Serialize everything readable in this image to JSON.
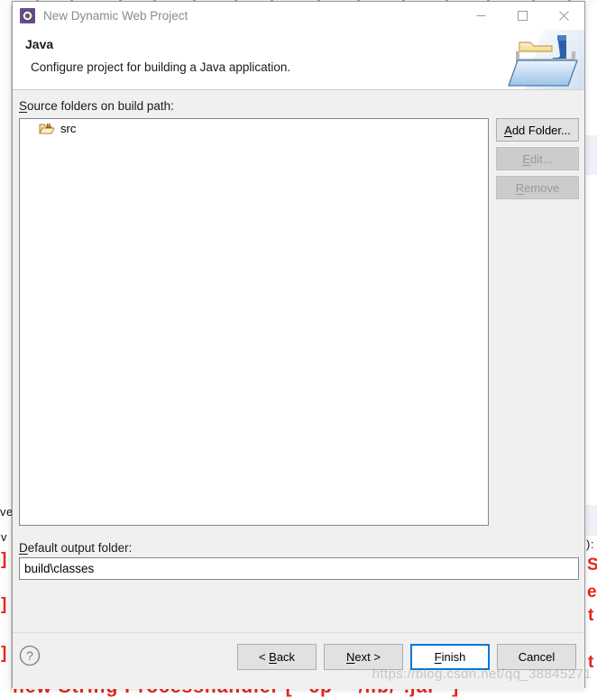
{
  "window": {
    "title": "New Dynamic Web Project",
    "icon": "eclipse-wizard-icon",
    "controls": {
      "minimize": "minimize-icon",
      "maximize": "maximize-icon",
      "close": "close-icon"
    }
  },
  "header": {
    "title": "Java",
    "description": "Configure project for building a Java application.",
    "banner_icon": "java-folder-banner-icon"
  },
  "form": {
    "source_folders_label": "Source folders on build path:",
    "source_folders_mnemonic": "S",
    "source_folders_rest": "ource folders on build path:",
    "source_list": [
      {
        "name": "src",
        "icon": "java-source-folder-icon"
      }
    ],
    "output_label_mnemonic": "D",
    "output_label_rest": "efault output folder:",
    "output_label": "Default output folder:",
    "output_value": "build\\classes",
    "output_placeholder": ""
  },
  "side_buttons": [
    {
      "name": "add-folder",
      "mnemonic": "A",
      "pre": "",
      "rest": "dd Folder...",
      "label": "Add Folder...",
      "enabled": true
    },
    {
      "name": "edit",
      "mnemonic": "E",
      "pre": "",
      "rest": "dit...",
      "label": "Edit...",
      "enabled": false
    },
    {
      "name": "remove",
      "mnemonic": "R",
      "pre": "",
      "rest": "emove",
      "label": "Remove",
      "enabled": false
    }
  ],
  "footer": {
    "help_icon": "help-question-icon",
    "buttons": [
      {
        "name": "back",
        "pre": "< ",
        "mnemonic": "B",
        "rest": "ack",
        "label": "< Back",
        "default": false
      },
      {
        "name": "next",
        "pre": "",
        "mnemonic": "N",
        "rest": "ext >",
        "label": "Next >",
        "default": false
      },
      {
        "name": "finish",
        "pre": "",
        "mnemonic": "F",
        "rest": "inish",
        "label": "Finish",
        "default": true
      },
      {
        "name": "cancel",
        "pre": "",
        "mnemonic": "",
        "rest": "Cancel",
        "label": "Cancel",
        "default": false
      }
    ]
  },
  "watermark": "https://blog.csdn.net/qq_38845271",
  "background": {
    "code_fragments": [
      "ve",
      "v",
      "]",
      "]",
      "]",
      "S",
      "e",
      "t",
      "t",
      "):"
    ],
    "bottom_code": "new String Processhandler [ \"cp\" \"/lib/*.jar\" ]"
  },
  "colors": {
    "accent": "#0078d7",
    "dialog_bg": "#f0f0f0",
    "field_bg": "#ffffff",
    "disabled_text": "#9a9a9a",
    "code_red": "#e8241c",
    "title_text": "#8a8a8a"
  }
}
